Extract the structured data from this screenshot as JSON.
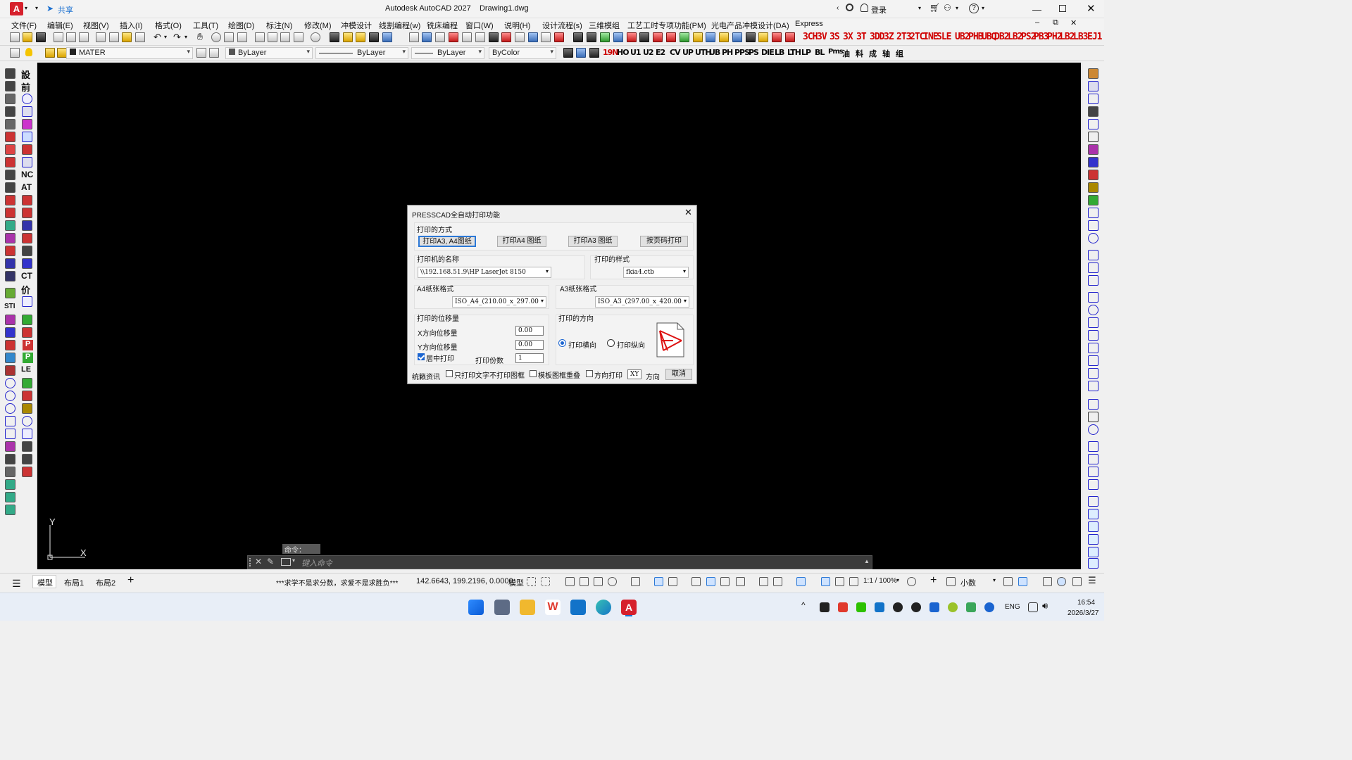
{
  "titlebar": {
    "app_logo": "A",
    "share_label": "共享",
    "title": "Autodesk AutoCAD 2027",
    "document": "Drawing1.dwg",
    "login_label": "登录",
    "icons": [
      "search-icon",
      "user-icon",
      "cart-icon",
      "people-icon",
      "help-icon",
      "minimize-icon",
      "maximize-icon",
      "close-icon"
    ]
  },
  "menu": [
    "文件(F)",
    "编辑(E)",
    "视图(V)",
    "插入(I)",
    "格式(O)",
    "工具(T)",
    "绘图(D)",
    "标注(N)",
    "修改(M)",
    "冲模设计",
    "线割编程(w)",
    "铣床编程",
    "窗口(W)",
    "说明(H)",
    "设计流程(s)",
    "三维模组",
    "工艺工时专项功能(PM)",
    "光电产品冲模设计(DA)",
    "Express"
  ],
  "toolbar_red_labels": [
    "3CH",
    "3V",
    "3S",
    "3X",
    "3T",
    "3DD",
    "3Z",
    "2T3",
    "2TC",
    "INE",
    "SLE",
    "UB2",
    "PHB",
    "UBQ",
    "DB2",
    "LB2",
    "PS2",
    "PB3",
    "PH2",
    "LB2",
    "LB3",
    "EJ1"
  ],
  "toolbar_black_labels": [
    "19N",
    "HO",
    "U1",
    "U2",
    "E2",
    "CV",
    "UP",
    "UTH",
    "UB",
    "PH",
    "PPS",
    "PS",
    "DIE",
    "LB",
    "LTH",
    "LP",
    "BL",
    "Pms",
    "油",
    "料",
    "成",
    "轴",
    "组"
  ],
  "layer_bar": {
    "layer_name": "MATER",
    "color": "ByLayer",
    "linetype": "ByLayer",
    "lineweight": "ByLayer",
    "plotstyle": "ByColor"
  },
  "left_toolbar_text": [
    "設",
    "前",
    "NC",
    "AT",
    "STI",
    "价",
    "P",
    "P",
    "CT",
    "LE"
  ],
  "dialog": {
    "title": "PRESSCAD全自动打印功能",
    "print_mode": {
      "label": "打印的方式",
      "buttons": [
        "打印A3, A4图纸",
        "打印A4 图纸",
        "打印A3 图纸",
        "按页码打印"
      ]
    },
    "printer": {
      "label": "打印机的名称",
      "value": "\\\\192.168.51.9\\HP LaserJet 8150"
    },
    "style": {
      "label": "打印的样式",
      "value": "fkia4.ctb"
    },
    "a4": {
      "label": "A4纸张格式",
      "value": "ISO_A4_(210.00_x_297.00"
    },
    "a3": {
      "label": "A3纸张格式",
      "value": "ISO_A3_(297.00_x_420.00"
    },
    "offset": {
      "label": "打印的位移量",
      "x_label": "X方向位移量",
      "x_value": "0.00",
      "y_label": "Y方向位移量",
      "y_value": "0.00",
      "center_label": "居中打印",
      "center_checked": true,
      "copies_label": "打印份数",
      "copies_value": "1"
    },
    "orientation": {
      "label": "打印的方向",
      "landscape": "打印横向",
      "portrait": "打印纵向",
      "selected": "landscape"
    },
    "bottom": {
      "info": "统籁资讯",
      "text_only": "只打印文字不打印图框",
      "overlap": "模板图框重叠",
      "direction_print": "方向打印",
      "xy_value": "XY",
      "direction_label": "方向",
      "cancel": "取消"
    }
  },
  "command": {
    "prompt_label": "命令： MP",
    "placeholder": "键入命令"
  },
  "status": {
    "tabs": [
      "模型",
      "布局1",
      "布局2"
    ],
    "message": "***求学不是求分数，求爱不是求胜负***",
    "coords": "142.6643, 199.2196, 0.0000",
    "model": "模型",
    "scale": "1:1 / 100%",
    "units": "小数"
  },
  "taskbar": {
    "apps": [
      "windows-start",
      "calculator",
      "file-explorer",
      "wps",
      "outlook",
      "edge",
      "autocad"
    ],
    "lang": "ENG",
    "time": "16:54",
    "date": "2026/3/27"
  },
  "ucs": {
    "x": "X",
    "y": "Y"
  }
}
